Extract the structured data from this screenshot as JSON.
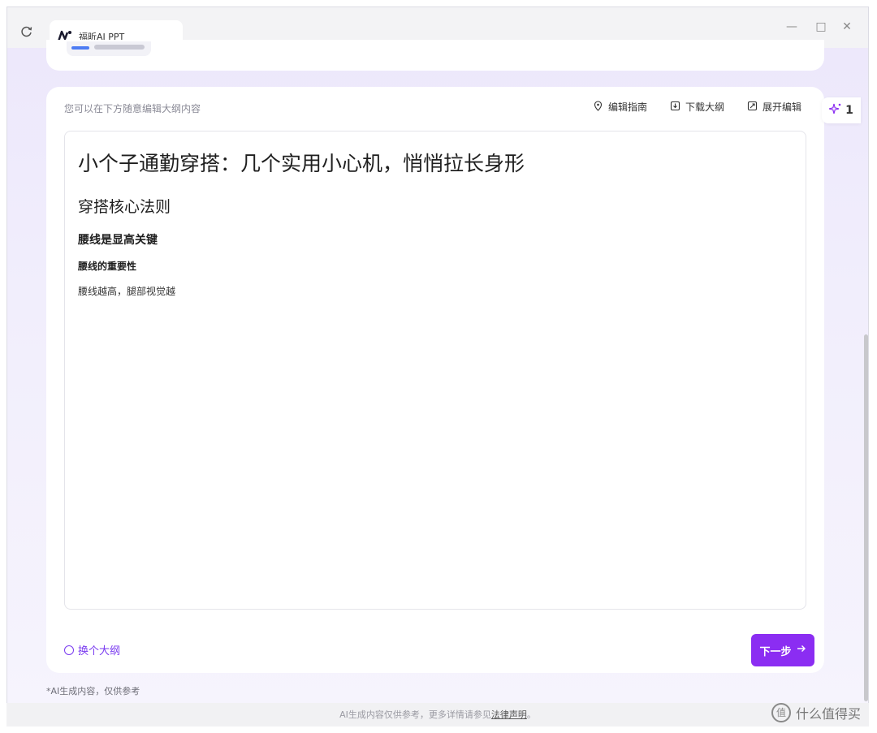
{
  "tab": {
    "title": "福昕AI PPT"
  },
  "window_controls": {
    "minimize": "—",
    "maximize": "□",
    "close": "✕"
  },
  "main": {
    "hint": "您可以在下方随意编辑大纲内容",
    "toolbar": [
      {
        "label": "编辑指南",
        "icon": "guide-icon"
      },
      {
        "label": "下载大纲",
        "icon": "download-icon"
      },
      {
        "label": "展开编辑",
        "icon": "expand-edit-icon"
      }
    ],
    "outline": {
      "title": "小个子通勤穿搭：几个实用小心机，悄悄拉长身形",
      "section": "穿搭核心法则",
      "subsection": "腰线是显高关键",
      "point": "腰线的重要性",
      "detail": "腰线越高，腿部视觉越"
    },
    "change_outline": "换个大纲",
    "next_button": "下一步"
  },
  "side_badge": {
    "count": "1"
  },
  "disclaimer": "*AI生成内容，仅供参考",
  "footer": {
    "text": "AI生成内容仅供参考，更多详情请参见",
    "link": "法律声明",
    "end": "。"
  },
  "watermark": {
    "text": "什么值得买",
    "logo": "值"
  }
}
